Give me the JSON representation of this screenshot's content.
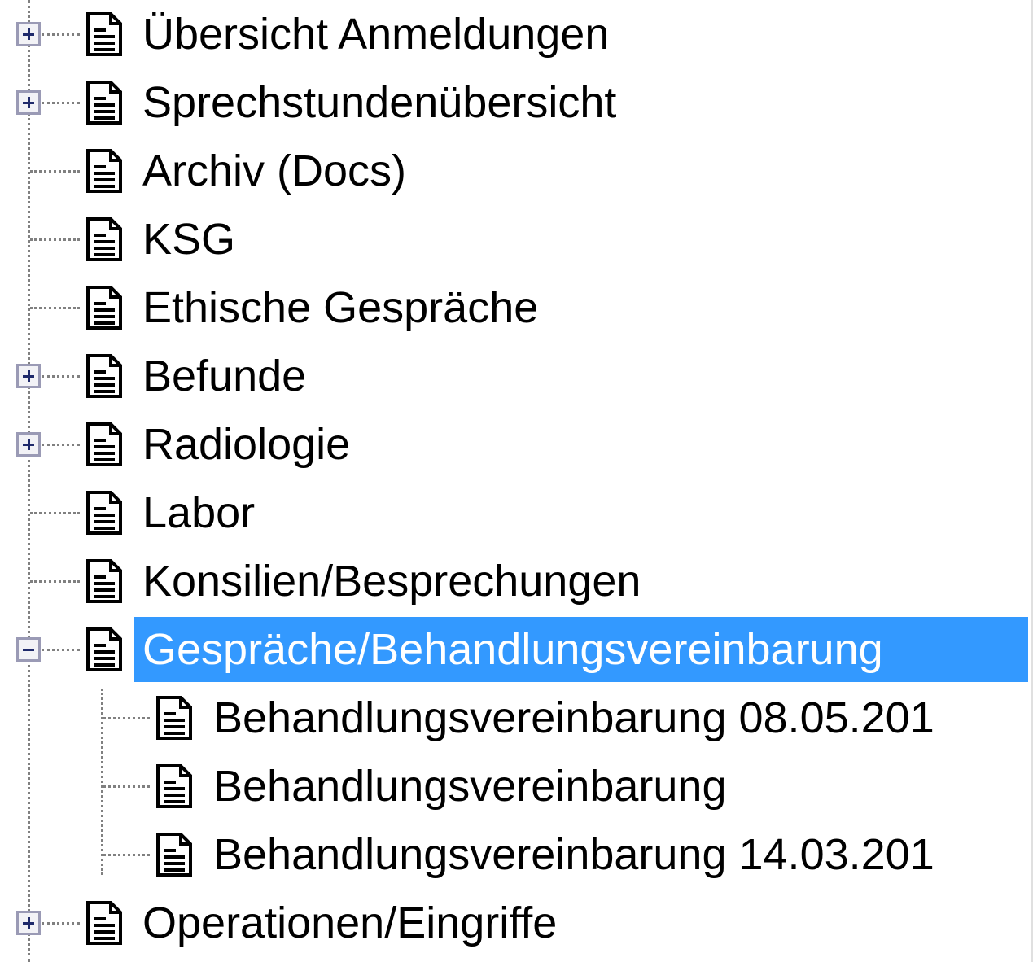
{
  "tree": {
    "items": [
      {
        "label": "Übersicht Anmeldungen",
        "level": 0,
        "expander": "plus",
        "selected": false
      },
      {
        "label": "Sprechstundenübersicht",
        "level": 0,
        "expander": "plus",
        "selected": false
      },
      {
        "label": "Archiv (Docs)",
        "level": 0,
        "expander": "none",
        "selected": false
      },
      {
        "label": "KSG",
        "level": 0,
        "expander": "none",
        "selected": false
      },
      {
        "label": "Ethische Gespräche",
        "level": 0,
        "expander": "none",
        "selected": false
      },
      {
        "label": "Befunde",
        "level": 0,
        "expander": "plus",
        "selected": false
      },
      {
        "label": "Radiologie",
        "level": 0,
        "expander": "plus",
        "selected": false
      },
      {
        "label": "Labor",
        "level": 0,
        "expander": "none",
        "selected": false
      },
      {
        "label": "Konsilien/Besprechungen",
        "level": 0,
        "expander": "none",
        "selected": false
      },
      {
        "label": "Gespräche/Behandlungsvereinbarung",
        "level": 0,
        "expander": "minus",
        "selected": true
      },
      {
        "label": "Behandlungsvereinbarung 08.05.201",
        "level": 1,
        "expander": "none",
        "selected": false
      },
      {
        "label": "Behandlungsvereinbarung",
        "level": 1,
        "expander": "none",
        "selected": false
      },
      {
        "label": "Behandlungsvereinbarung 14.03.201",
        "level": 1,
        "expander": "none",
        "selected": false
      },
      {
        "label": "Operationen/Eingriffe",
        "level": 0,
        "expander": "plus",
        "selected": false
      }
    ]
  },
  "colors": {
    "selection_bg": "#3399ff",
    "selection_text": "#ffffff",
    "tree_line": "#808080"
  },
  "icons": {
    "item": "document-icon",
    "expand": "plus-icon",
    "collapse": "minus-icon"
  }
}
